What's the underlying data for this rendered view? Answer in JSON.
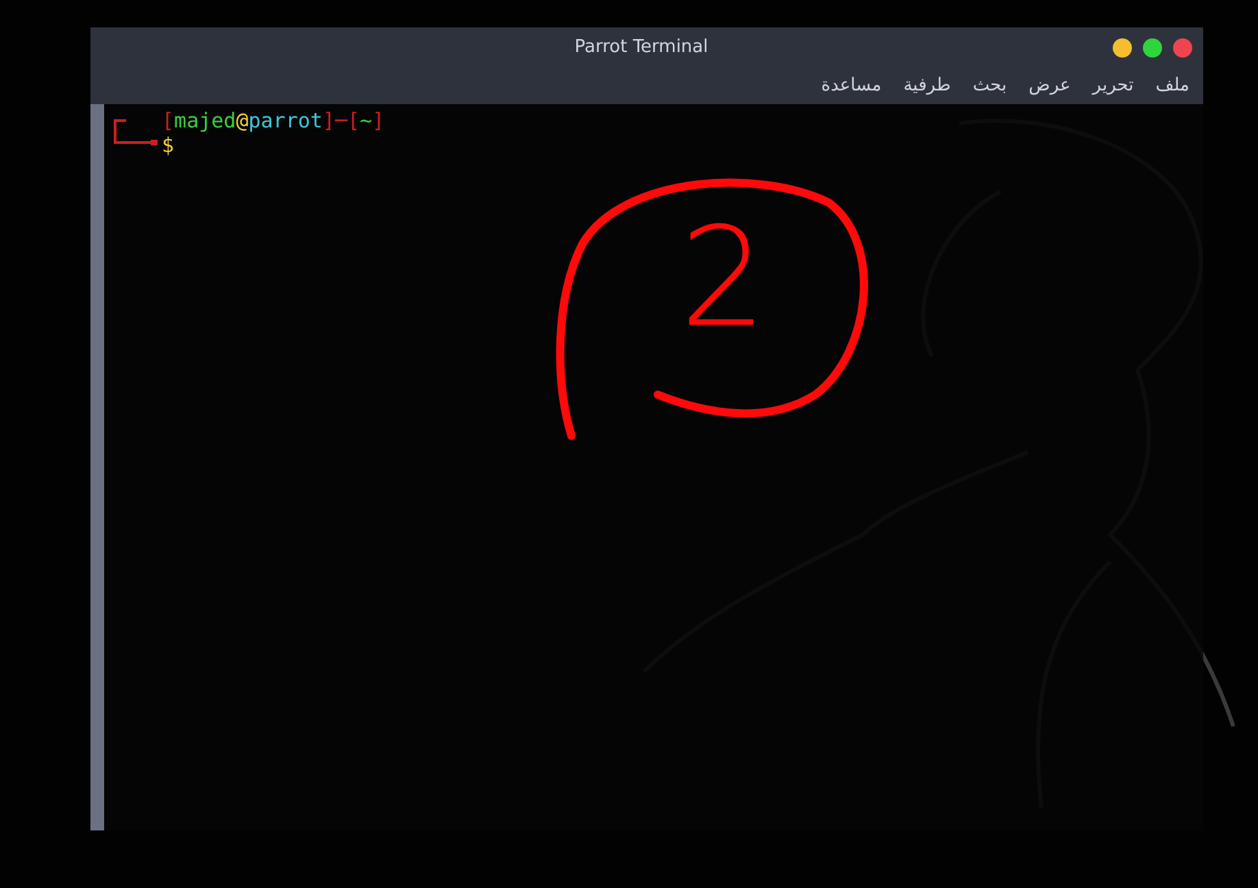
{
  "window": {
    "title": "Parrot Terminal",
    "controls": [
      {
        "color": "#f5be2e"
      },
      {
        "color": "#2fd53c"
      },
      {
        "color": "#f0444f"
      }
    ],
    "menu": [
      "ملف",
      "تحرير",
      "عرض",
      "بحث",
      "طرفية",
      "مساعدة"
    ]
  },
  "terminal": {
    "lines": [
      {
        "text": "[majed@parrot]─[~]"
      },
      {
        "text": "$"
      }
    ]
  },
  "annotation": {
    "label": "2"
  }
}
